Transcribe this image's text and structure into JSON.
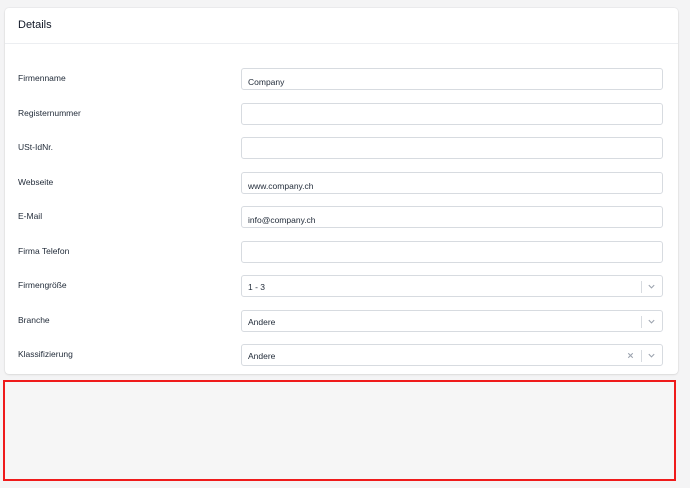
{
  "card": {
    "title": "Details"
  },
  "fields": [
    {
      "label": "Firmenname",
      "value": "Company",
      "type": "text"
    },
    {
      "label": "Registernummer",
      "value": "",
      "type": "text"
    },
    {
      "label": "USt-IdNr.",
      "value": "",
      "type": "text"
    },
    {
      "label": "Webseite",
      "value": "www.company.ch",
      "type": "text"
    },
    {
      "label": "E-Mail",
      "value": "info@company.ch",
      "type": "text"
    },
    {
      "label": "Firma Telefon",
      "value": "",
      "type": "text"
    },
    {
      "label": "Firmengröße",
      "value": "1 - 3",
      "type": "select"
    },
    {
      "label": "Branche",
      "value": "Andere",
      "type": "select"
    },
    {
      "label": "Klassifizierung",
      "value": "Andere",
      "type": "select",
      "clearable": true
    }
  ],
  "colors": {
    "highlight_border": "#ef1b1b",
    "field_border": "#d7dbe0"
  }
}
